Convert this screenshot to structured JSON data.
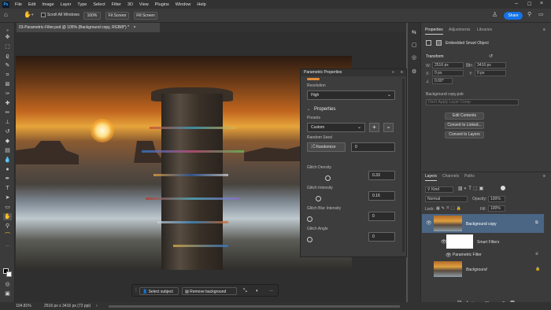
{
  "app": {
    "logo_text": "Ps"
  },
  "menu": [
    "File",
    "Edit",
    "Image",
    "Layer",
    "Type",
    "Select",
    "Filter",
    "3D",
    "View",
    "Plugins",
    "Window",
    "Help"
  ],
  "options_bar": {
    "scroll_all_windows": "Scroll All Windows",
    "zoom": "100%",
    "fit_screen": "Fit Screen",
    "fill_screen": "Fill Screen",
    "share": "Share"
  },
  "document": {
    "tab_title": "03-Parametric-Filter.psd @ 105% (Background copy, RGB/8*) *",
    "close": "×"
  },
  "parametric": {
    "title": "Parametric Properties",
    "resolution_label": "Resolution",
    "resolution_value": "High",
    "properties_heading": "Properties",
    "presets_label": "Presets",
    "presets_value": "Custom",
    "random_seed_label": "Random Seed",
    "randomize_label": "Randomize",
    "seed_value": "0",
    "glitch_density_label": "Glitch Density",
    "glitch_density_value": "0.33",
    "glitch_density_level": 0.33,
    "glitch_intensity_label": "Glitch Intensity",
    "glitch_intensity_value": "0.16",
    "glitch_intensity_level": 0.16,
    "glitch_blur_label": "Glitch Blur Intensity",
    "glitch_blur_value": "0",
    "glitch_angle_label": "Glitch Angle",
    "glitch_angle_value": "0"
  },
  "properties_panel": {
    "tabs": [
      "Properties",
      "Adjustments",
      "Libraries"
    ],
    "type": "Embedded Smart Object",
    "transform_heading": "Transform",
    "w_label": "W:",
    "w_value": "2516 px",
    "h_label": "H:",
    "h_value": "3416 px",
    "x_label": "X:",
    "x_value": "0 px",
    "y_label": "Y:",
    "y_value": "0 px",
    "angle_value": "0.00°",
    "source_file": "Background copy.psb",
    "layer_comp_placeholder": "Don't Apply Layer Comp",
    "edit_contents": "Edit Contents",
    "convert_linked": "Convert to Linked...",
    "convert_layers": "Convert to Layers"
  },
  "layers_panel": {
    "tabs": [
      "Layers",
      "Channels",
      "Paths"
    ],
    "kind": "Kind",
    "blend_mode": "Normal",
    "opacity_label": "Opacity:",
    "opacity_value": "100%",
    "lock_label": "Lock:",
    "fill_label": "Fill:",
    "fill_value": "100%",
    "layers": [
      {
        "name": "Background copy"
      },
      {
        "name": "Smart Filters"
      },
      {
        "name": "Parametric Filter"
      },
      {
        "name": "Background"
      }
    ]
  },
  "context_bar": {
    "select_subject": "Select subject",
    "remove_background": "Remove background",
    "more": "···"
  },
  "status": {
    "zoom": "104.81%",
    "doc_info": "2516 px x 3416 px (72 ppi)"
  },
  "colors": {
    "accent": "#1473e6",
    "selected_layer": "#4b6584"
  }
}
